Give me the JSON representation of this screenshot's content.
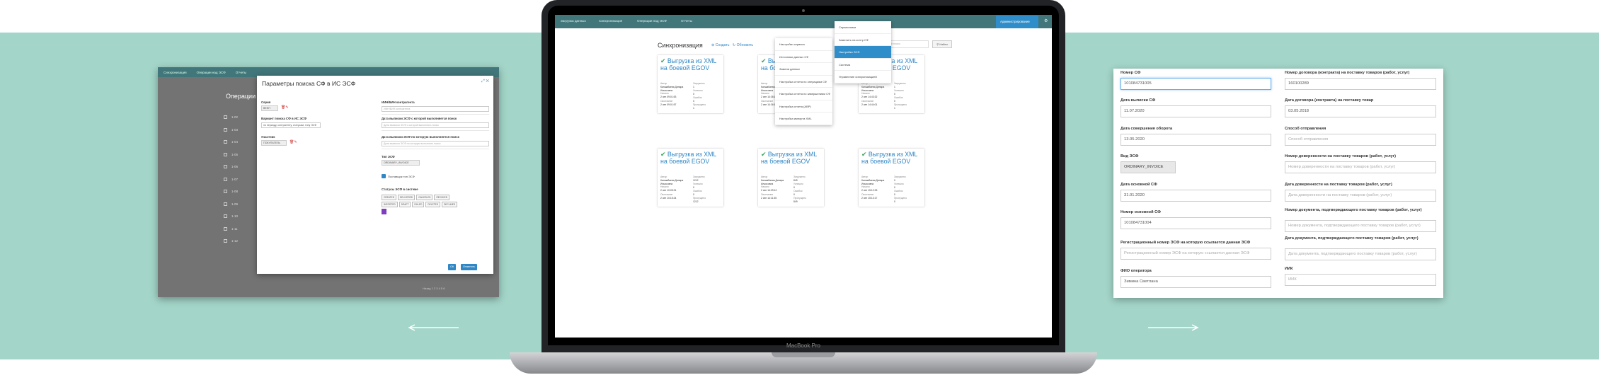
{
  "colors": {
    "band": "#a3d5c8",
    "navbar": "#41767a",
    "accent": "#2f87c6",
    "success": "#3aa55a",
    "active_menu": "#2f8ec9",
    "purple": "#7e3fbf"
  },
  "left": {
    "nav": [
      "Синхронизация",
      "Операции над ЭСФ",
      "Отчеты"
    ],
    "bg_title": "Операции",
    "rows": [
      "1-02",
      "1-03",
      "1-04",
      "1-05",
      "1-06",
      "1-07",
      "1-08",
      "1-09",
      "1-10",
      "1-11",
      "1-12"
    ],
    "pager": "Назад  1  2  3  4  5  6",
    "dialog": {
      "title": "Параметры поиска СФ в ИС ЭСФ",
      "series_label": "Серия",
      "series_value": "ВЕЕП",
      "variant_label": "Вариант поиска СФ в ИС ЭСФ",
      "variant_value": "по периоду, контрагенту, статусам, типу ЭСФ",
      "participant_label": "Участник",
      "participant_value": "ПОКУПАТЕЛЬ",
      "iin_label": "ИИН/БИН контрагента",
      "iin_placeholder": "ИИН/БИН контрагента",
      "date_from_label": "Дата выписки ЭСФ с которой выполняется поиск",
      "date_from_placeholder": "Дата выписки ЭСФ с которой выполнять поиск",
      "date_to_label": "Дата выписки ЭСФ по которую выполняется поиск",
      "date_to_placeholder": "Дата выписки ЭСФ по которую выполнять поиск",
      "type_label": "Тип ЭСФ",
      "type_value": "ORDINARY_INVOICE",
      "checkbox_label": "Поставщик тип ЭСФ",
      "statuses_label": "Статусы ЭСФ в системе",
      "statuses": [
        "CREATED",
        "DELIVERED",
        "CANCELED",
        "REVOKED",
        "IMPORTED",
        "DRAFT",
        "FAILED",
        "DELETED",
        "DECLINED"
      ],
      "ok_label": "ОК",
      "cancel_label": "Отменить"
    }
  },
  "laptop": {
    "brand": "MacBook Pro",
    "nav": [
      "Загрузка данных",
      "Синхронизация",
      "Операции над ЭСФ",
      "Отчеты"
    ],
    "admin_label": "Администрирование",
    "page_title": "Синхронизация",
    "create_link": "Создать",
    "refresh_link": "Обновить",
    "search_placeholder": "Расширенный поиск",
    "find_button": "Найти",
    "card_title": "Выгрузка из XML на боевой EGOV",
    "cards": [
      {
        "user": "Капшабаева Динара Ильясовна",
        "start": "2 сен 09:01:53",
        "end": "2 сен 09:01:57",
        "stat1": "1",
        "stat2": "0",
        "stat3": "0",
        "stat4": "1"
      },
      {
        "user": "Капшабаева Динара Ильясовна",
        "start": "2 сен 14:36:10",
        "end": "2 сен 14:36:11",
        "stat1": "1",
        "stat2": "0",
        "stat3": "0",
        "stat4": "1"
      },
      {
        "user": "Капшабаева Динара Ильясовна",
        "start": "2 сен 14:43:32",
        "end": "2 сен 14:44:01",
        "stat1": "1",
        "stat2": "0",
        "stat3": "0",
        "stat4": "1"
      },
      {
        "user": "Капшабаева Динара Ильясовна",
        "start": "2 сен 10:05:31",
        "end": "2 сен 10:15:24",
        "stat1": "1212",
        "stat2": "0",
        "stat3": "0",
        "stat4": "1212"
      },
      {
        "user": "Капшабаева Динара Ильясовна",
        "start": "2 сен 14:09:12",
        "end": "2 сен 14:11:35",
        "stat1": "849",
        "stat2": "0",
        "stat3": "0",
        "stat4": "849"
      },
      {
        "user": "Капшабаева Динара Ильясовна",
        "start": "2 сен 15:12:33",
        "end": "2 сен 15:13:17",
        "stat1": "0",
        "stat2": "0",
        "stat3": "0",
        "stat4": "0"
      }
    ],
    "field_labels": [
      "Автор",
      "Начало",
      "Окончание",
      "Загружено",
      "Успешно",
      "Ошибок",
      "Пропущено"
    ],
    "menu_left": [
      "Настройки сервиса",
      "Источники данных СФ",
      "Замена данных",
      "Настройка отчета по операциям СФ",
      "Настройка отчета по завершениям СФ",
      "Настройка отчета (АВР)",
      "Настройка импорта XML"
    ],
    "menu_right": [
      "Справочники",
      "Заменить на контр СФ",
      "Настройки ЭСФ",
      "Система",
      "Управление синхронизацией"
    ],
    "menu_right_active": 2
  },
  "right": {
    "fields_left": [
      {
        "label": "Номер СФ",
        "value": "101084731005",
        "placeholder": false
      },
      {
        "label": "Дата выписки СФ",
        "value": "11.07.2020",
        "placeholder": false
      },
      {
        "label": "Дата совершения оборота",
        "value": "13.05.2020",
        "placeholder": false
      },
      {
        "label": "Вид ЭСФ",
        "value": "ORDINARY_INVOICE",
        "placeholder": false
      },
      {
        "label": "Дата основной СФ",
        "value": "31.01.2020",
        "placeholder": false
      },
      {
        "label": "Номер основной СФ",
        "value": "101084731004",
        "placeholder": false
      },
      {
        "label": "Регистрационный номер ЭСФ на которую ссылается данная ЭСФ",
        "value": "Регистрационный номер ЭСФ на которую ссылается данная ЭСФ",
        "placeholder": true
      },
      {
        "label": "ФИО оператора",
        "value": "Зимина Светлана",
        "placeholder": false
      }
    ],
    "fields_right": [
      {
        "label": "Номер договора (контракта) на поставку товаров (работ, услуг)",
        "value": "160100289",
        "placeholder": false
      },
      {
        "label": "Дата договора (контракта) на поставку товар",
        "value": "03.05.2018",
        "placeholder": false
      },
      {
        "label": "Способ отправления",
        "value": "Способ отправления",
        "placeholder": true
      },
      {
        "label": "Номер доверенности на поставку товаров (работ, услуг)",
        "value": "Номер доверенности на поставку товаров (работ, услуг)",
        "placeholder": true
      },
      {
        "label": "Дата доверенности на поставку товаров (работ, услуг)",
        "value": "Дата доверенности на поставку товаров (работ, услуг)",
        "placeholder": true
      },
      {
        "label": "Номер документа, подтверждающего поставку товаров (работ, услуг)",
        "value": "Номер документа, подтверждающего поставку товаров (работ, услуг)",
        "placeholder": true
      },
      {
        "label": "Дата документа, подтверждающего поставку товаров (работ, услуг)",
        "value": "Дата документа, подтверждающего поставку товаров (работ, услуг)",
        "placeholder": true
      },
      {
        "label": "ИИК",
        "value": "ИИК",
        "placeholder": true
      }
    ]
  }
}
